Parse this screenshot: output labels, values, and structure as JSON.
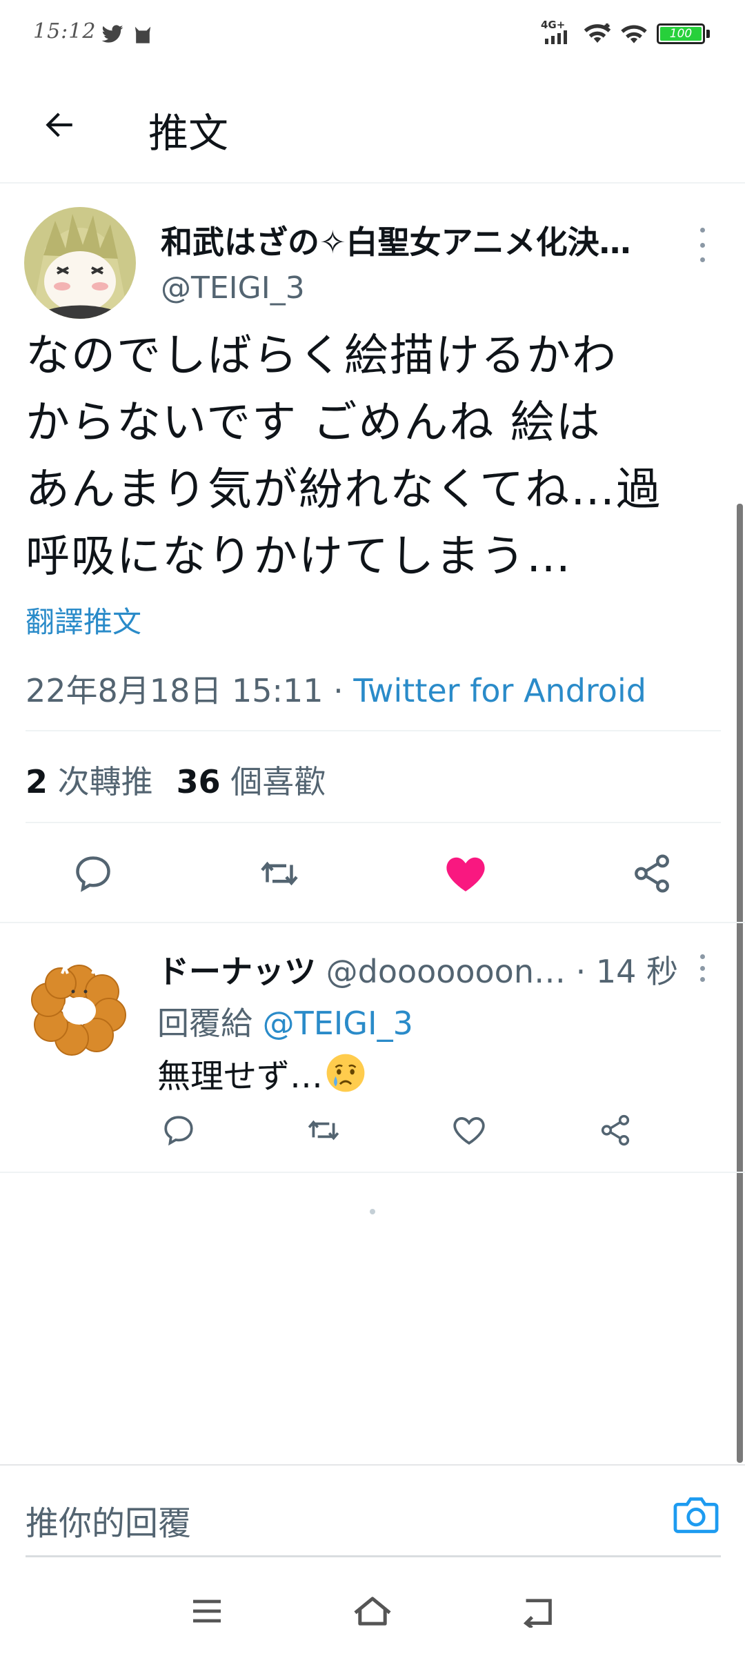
{
  "status_bar": {
    "time": "15:12",
    "network": "4G+",
    "battery": "100",
    "icons": [
      "twitter-icon",
      "cat-icon",
      "signal-icon",
      "wifi-icon",
      "wifi-icon",
      "battery-icon"
    ]
  },
  "header": {
    "back_icon": "arrow-left-icon",
    "title": "推文"
  },
  "tweet": {
    "author_name": "和武はざの✧白聖女アニメ化決…",
    "author_handle": "@TEIGI_3",
    "text": "なのでしばらく絵描けるかわ\nからないです ごめんね 絵は\nあんまり気が紛れなくてね…過\n呼吸になりかけてしまう…",
    "translate_label": "翻譯推文",
    "date": "22年8月18日 15:11",
    "separator": " · ",
    "source": "Twitter for Android",
    "retweet_count": "2",
    "retweet_label": "次轉推",
    "like_count": "36",
    "like_label": "個喜歡",
    "liked": true,
    "like_color": "#f91880"
  },
  "reply": {
    "author_name": "ドーナッツ",
    "author_handle": "@dooooooon…",
    "time": " · 14 秒",
    "reply_to_label": "回覆給 ",
    "reply_to_mention": "@TEIGI_3",
    "text": "無理せず…",
    "emoji": "crying-face-emoji"
  },
  "composer": {
    "placeholder": "推你的回覆",
    "camera_icon": "camera-icon"
  },
  "nav": {
    "icons": [
      "menu-icon",
      "home-icon",
      "back-icon"
    ]
  },
  "colors": {
    "link": "#2a8bc9",
    "secondary_text": "#536471",
    "like": "#f91880"
  }
}
